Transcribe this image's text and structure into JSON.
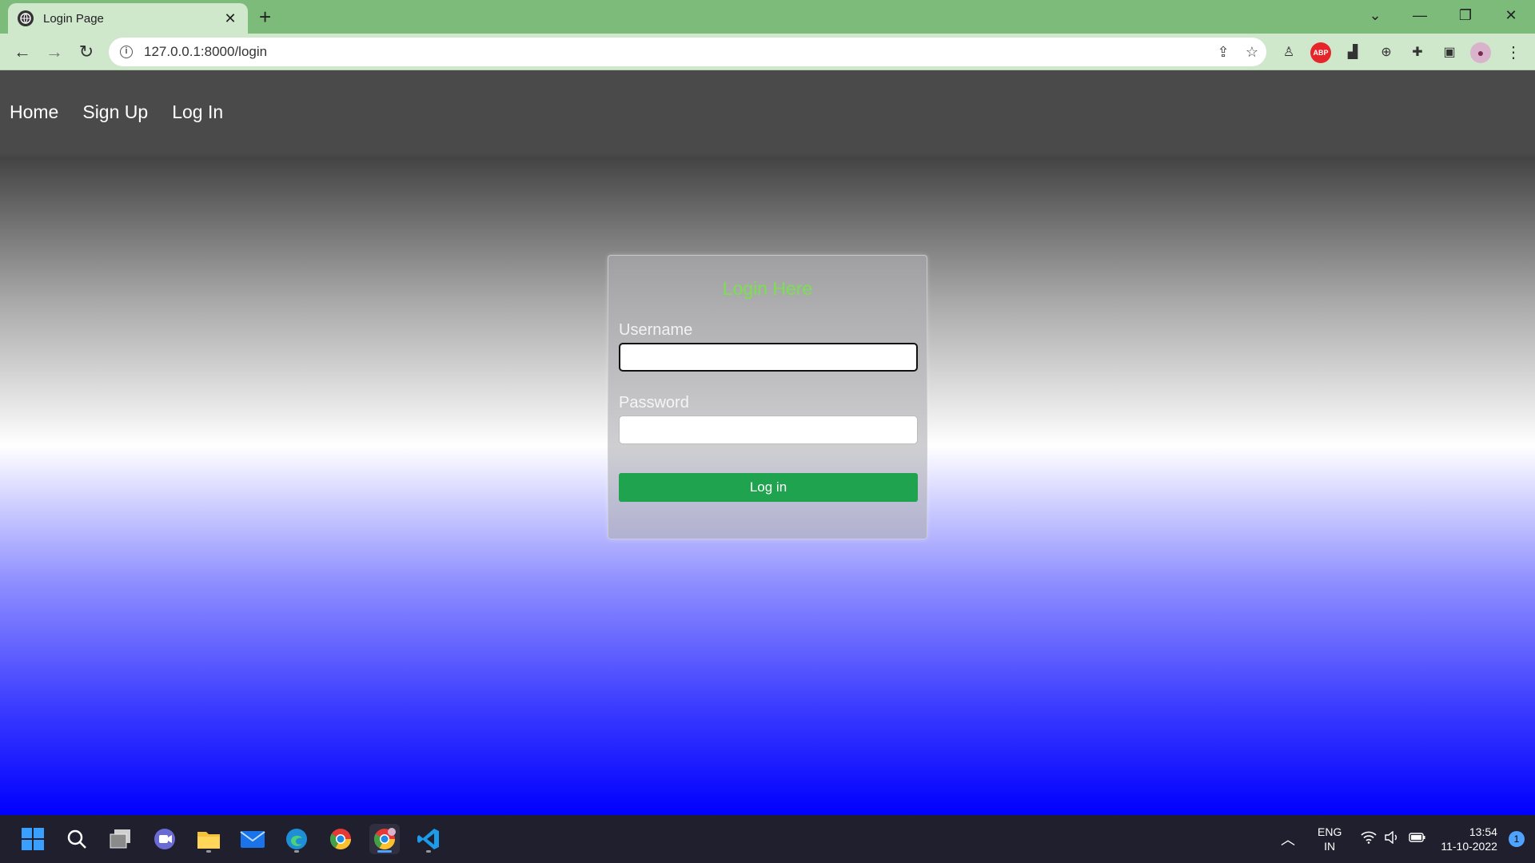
{
  "browser": {
    "tab_title": "Login Page",
    "url": "127.0.0.1:8000/login",
    "omnibox_icons": [
      "share-icon",
      "bookmark-star-icon"
    ],
    "extensions": [
      "extension-avatar-icon",
      "adblock-icon",
      "extension-chart-icon",
      "extension-globe-icon",
      "puzzle-icon",
      "sidepanel-icon",
      "profile-avatar",
      "menu-icon"
    ],
    "abp_label": "ABP"
  },
  "navbar": {
    "items": [
      {
        "label": "Home"
      },
      {
        "label": "Sign Up"
      },
      {
        "label": "Log In"
      }
    ]
  },
  "login_form": {
    "title": "Login Here",
    "username_label": "Username",
    "username_value": "",
    "password_label": "Password",
    "password_value": "",
    "submit_label": "Log in",
    "title_color": "#7be04f",
    "button_color": "#1fa34f"
  },
  "taskbar": {
    "apps": [
      "windows-start-icon",
      "search-icon",
      "task-view-icon",
      "teams-icon",
      "file-explorer-icon",
      "mail-icon",
      "edge-icon",
      "chrome-icon",
      "chrome-profile-icon",
      "vscode-icon"
    ],
    "language": {
      "line1": "ENG",
      "line2": "IN"
    },
    "time": "13:54",
    "date": "11-10-2022",
    "notifications": "1"
  }
}
